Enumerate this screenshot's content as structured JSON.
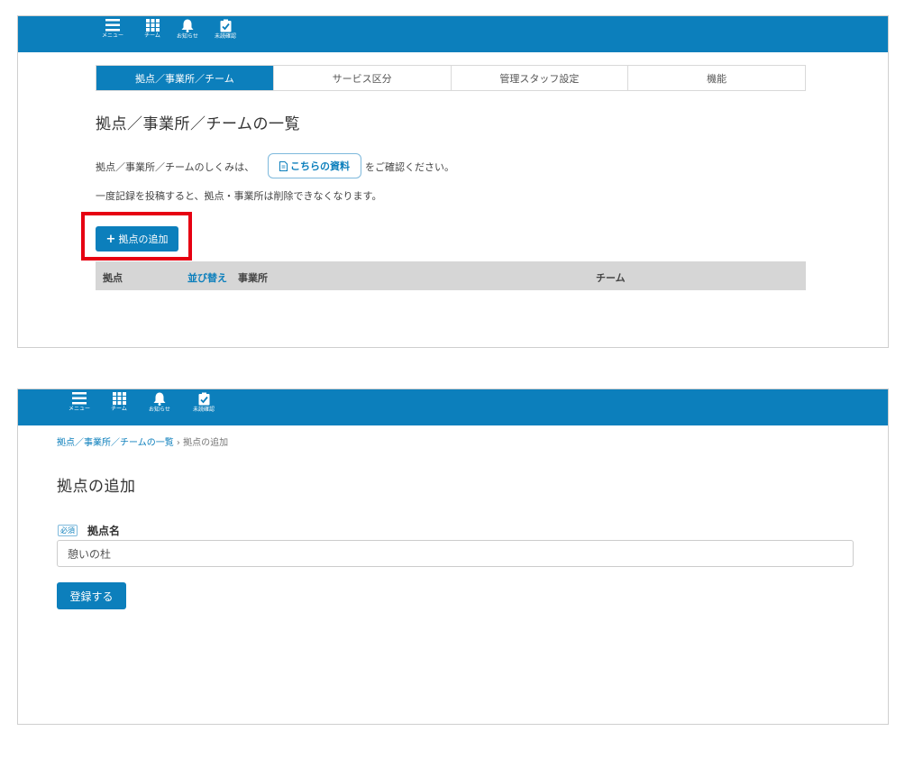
{
  "nav": {
    "items": [
      {
        "label": "メニュー",
        "icon": "menu-icon"
      },
      {
        "label": "チーム",
        "icon": "grid-icon"
      },
      {
        "label": "お知らせ",
        "icon": "bell-icon"
      },
      {
        "label": "未読確認",
        "icon": "clipboard-check-icon"
      }
    ]
  },
  "list_page": {
    "tabs": [
      {
        "label": "拠点／事業所／チーム",
        "active": true
      },
      {
        "label": "サービス区分",
        "active": false
      },
      {
        "label": "管理スタッフ設定",
        "active": false
      },
      {
        "label": "機能",
        "active": false
      }
    ],
    "title": "拠点／事業所／チームの一覧",
    "info_prefix": "拠点／事業所／チームのしくみは、",
    "doc_button": "こちらの資料",
    "info_suffix": "をご確認ください。",
    "notice": "一度記録を投稿すると、拠点・事業所は削除できなくなります。",
    "add_button": "拠点の追加",
    "table_headers": {
      "base": "拠点",
      "sort": "並び替え",
      "office": "事業所",
      "team": "チーム"
    }
  },
  "add_page": {
    "breadcrumb_link": "拠点／事業所／チームの一覧",
    "breadcrumb_sep": "›",
    "breadcrumb_current": "拠点の追加",
    "title": "拠点の追加",
    "required_badge": "必須",
    "field_label": "拠点名",
    "field_value": "憩いの杜",
    "submit_button": "登録する"
  },
  "colors": {
    "brand": "#0c7fbc",
    "highlight": "#e60012"
  }
}
